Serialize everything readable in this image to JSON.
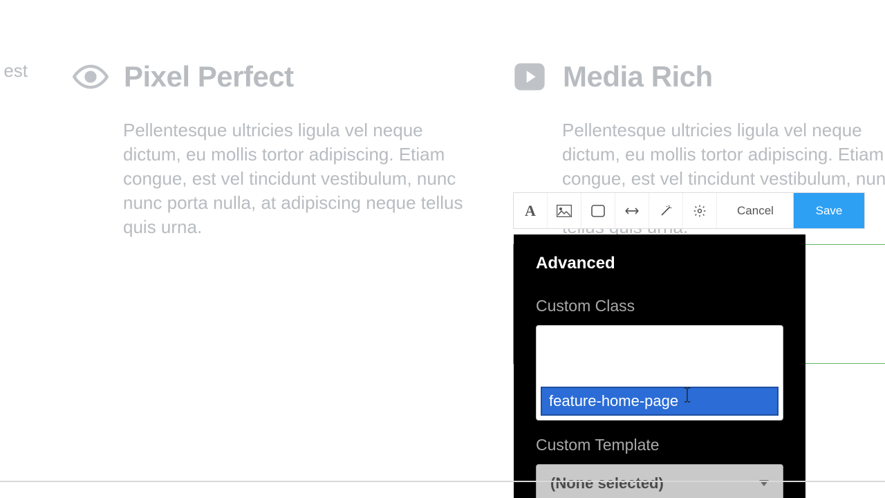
{
  "features": {
    "fragment": {
      "body": "um, est"
    },
    "left": {
      "title": "Pixel Perfect",
      "body": "Pellentesque ultricies ligula vel neque dictum, eu mollis tortor adipiscing. Etiam congue, est vel tincidunt vestibulum, nunc nunc porta nulla, at adipiscing neque tellus quis urna."
    },
    "right": {
      "title": "Media Rich",
      "body": "Pellentesque ultricies ligula vel neque dictum, eu mollis tortor adipiscing. Etiam congue, est vel tincidunt vestibulum, nunc nunc porta nulla, at adipiscing neque tellus quis urna."
    }
  },
  "toolbar": {
    "cancel_label": "Cancel",
    "save_label": "Save"
  },
  "advanced": {
    "heading": "Advanced",
    "custom_class_label": "Custom Class",
    "custom_class_value": "feature-home-page",
    "custom_template_label": "Custom Template",
    "custom_template_value": "(None selected)"
  },
  "colors": {
    "accent": "#2ea0f4",
    "selection": "#5fb65f",
    "chip": "#2b6cd6"
  }
}
